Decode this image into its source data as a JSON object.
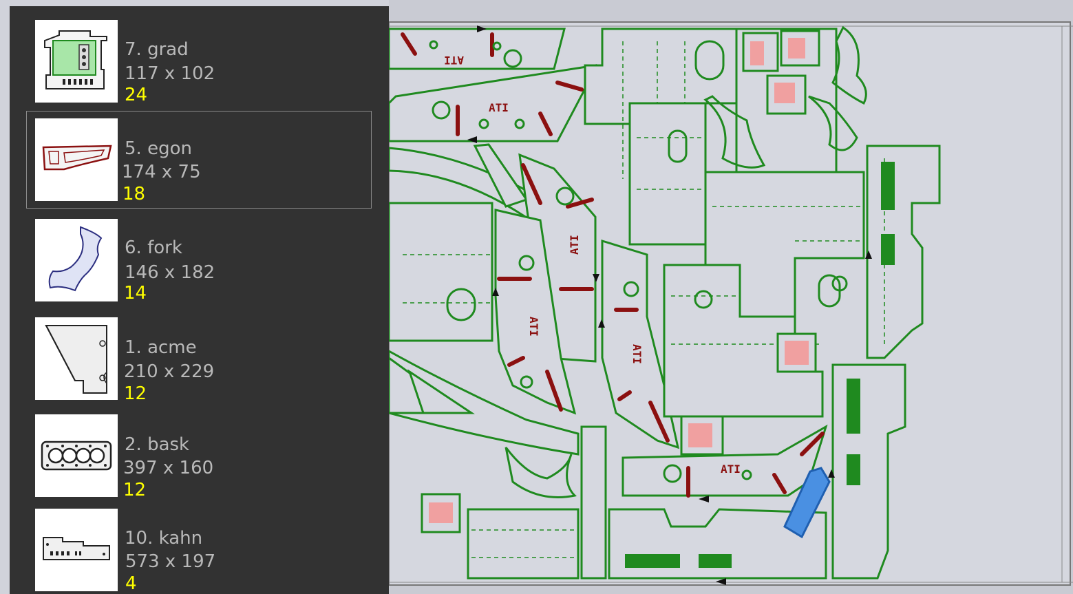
{
  "parts_list": [
    {
      "name": "7. grad",
      "size": "117 x 102",
      "quantity": "24",
      "selected": false,
      "thumbnail_icon": "grad-part-thumbnail"
    },
    {
      "name": "5. egon",
      "size": "174 x 75",
      "quantity": "18",
      "selected": true,
      "thumbnail_icon": "egon-part-thumbnail"
    },
    {
      "name": "6. fork",
      "size": "146 x 182",
      "quantity": "14",
      "selected": false,
      "thumbnail_icon": "fork-part-thumbnail"
    },
    {
      "name": "1. acme",
      "size": "210 x 229",
      "quantity": "12",
      "selected": false,
      "thumbnail_icon": "acme-part-thumbnail"
    },
    {
      "name": "2. bask",
      "size": "397 x 160",
      "quantity": "12",
      "selected": false,
      "thumbnail_icon": "bask-part-thumbnail"
    },
    {
      "name": "10. kahn",
      "size": "573 x 197",
      "quantity": "4",
      "selected": false,
      "thumbnail_icon": "kahn-part-thumbnail"
    }
  ],
  "canvas": {
    "part_label": "ATI",
    "colors": {
      "sheet_bg": "#d5d7df",
      "part_fill": "#d6d8e0",
      "part_outline": "#1f8a1f",
      "slot_outline": "#8b1010",
      "highlight": "#4a90e2",
      "pink_fill": "#f0a0a0"
    }
  },
  "colors": {
    "panel_bg": "#323232",
    "text_gray": "#b9b9b9",
    "quantity_yellow": "#ffff00",
    "selection_border": "#8a8a8a"
  }
}
